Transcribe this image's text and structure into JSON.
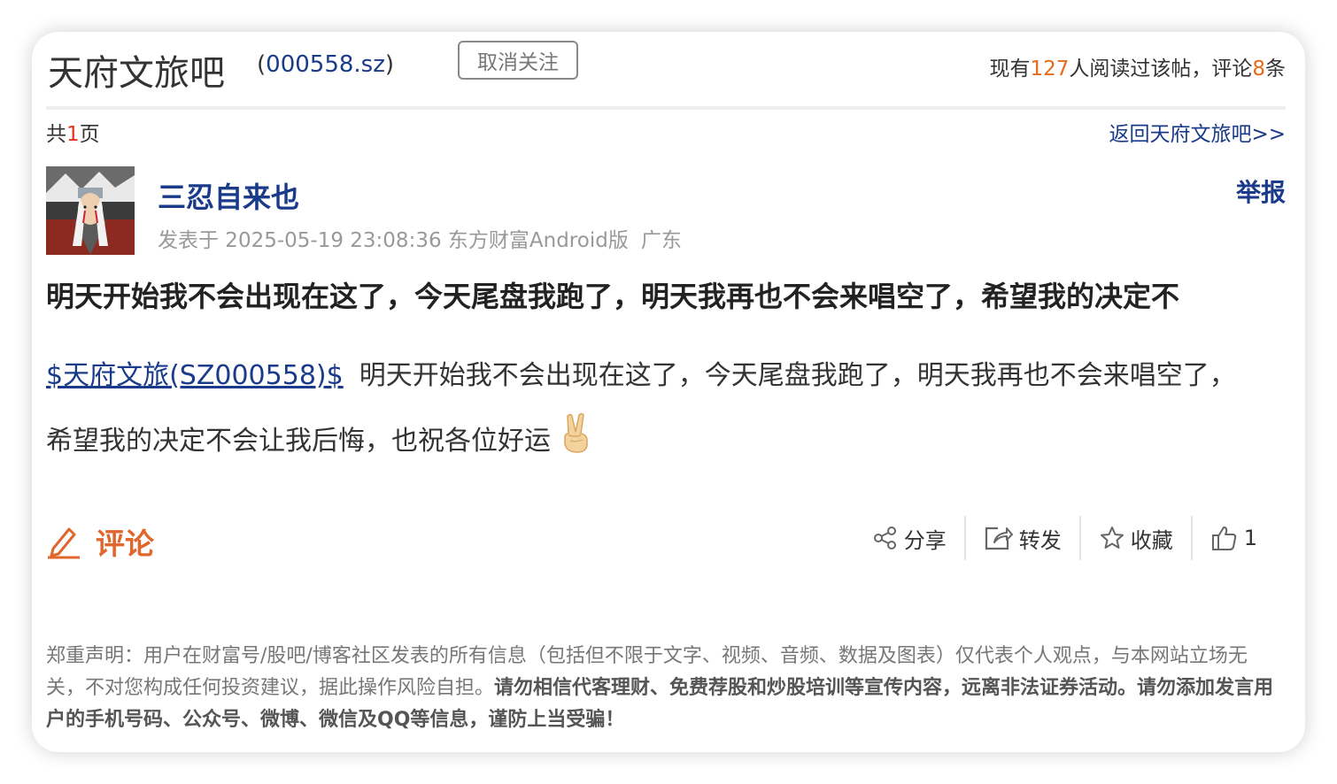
{
  "header": {
    "bar_title": "天府文旅吧",
    "code_open": "(",
    "code": "000558.sz",
    "code_close": ")",
    "unfollow_label": "取消关注",
    "stats_prefix": "现有",
    "read_count": "127",
    "stats_middle": "人阅读过该帖，评论",
    "comment_count": "8",
    "stats_suffix": "条"
  },
  "pager": {
    "prefix": "共",
    "pages": "1",
    "suffix": "页",
    "back_link": "返回天府文旅吧>>"
  },
  "post": {
    "author": "三忍自来也",
    "report_label": "举报",
    "meta": "发表于 2025-05-19 23:08:36 东方财富Android版",
    "location": "广东",
    "title": "明天开始我不会出现在这了，今天尾盘我跑了，明天我再也不会来唱空了，希望我的决定不",
    "stock_link": "$天府文旅(SZ000558)$",
    "body": "明天开始我不会出现在这了，今天尾盘我跑了，明天我再也不会来唱空了，希望我的决定不会让我后悔，也祝各位好运",
    "emoji_icon": "victory-hand-icon"
  },
  "actions": {
    "comment_label": "评论",
    "share_label": "分享",
    "forward_label": "转发",
    "favorite_label": "收藏",
    "like_count": "1"
  },
  "disclaimer": {
    "normal": "郑重声明：用户在财富号/股吧/博客社区发表的所有信息（包括但不限于文字、视频、音频、数据及图表）仅代表个人观点，与本网站立场无关，不对您构成任何投资建议，据此操作风险自担。",
    "bold": "请勿相信代客理财、免费荐股和炒股培训等宣传内容，远离非法证券活动。请勿添加发言用户的手机号码、公众号、微博、微信及QQ等信息，谨防上当受骗！"
  },
  "colors": {
    "accent_blue": "#1a3b8a",
    "accent_orange": "#e86a1b",
    "comment_orange": "#e0662c"
  }
}
